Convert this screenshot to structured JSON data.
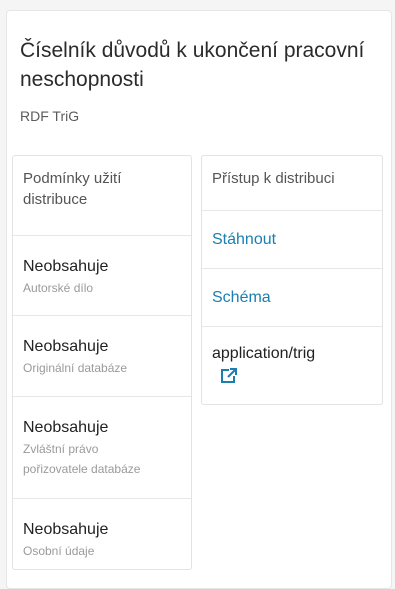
{
  "dataset": {
    "title": "Číselník důvodů k ukončení pracovní neschopnosti",
    "format": "RDF TriG"
  },
  "terms": {
    "header": "Podmínky užití distribuce",
    "items": [
      {
        "value": "Neobsahuje",
        "label": "Autorské dílo"
      },
      {
        "value": "Neobsahuje",
        "label": "Originální databáze"
      },
      {
        "value": "Neobsahuje",
        "label": "Zvláštní právo pořizovatele databáze"
      },
      {
        "value": "Neobsahuje",
        "label": "Osobní údaje"
      }
    ]
  },
  "access": {
    "header": "Přístup k distribuci",
    "download_label": "Stáhnout",
    "schema_label": "Schéma",
    "media_type": "application/trig",
    "media_type_icon": "external-link-icon"
  },
  "colors": {
    "link": "#1a7fb0"
  }
}
